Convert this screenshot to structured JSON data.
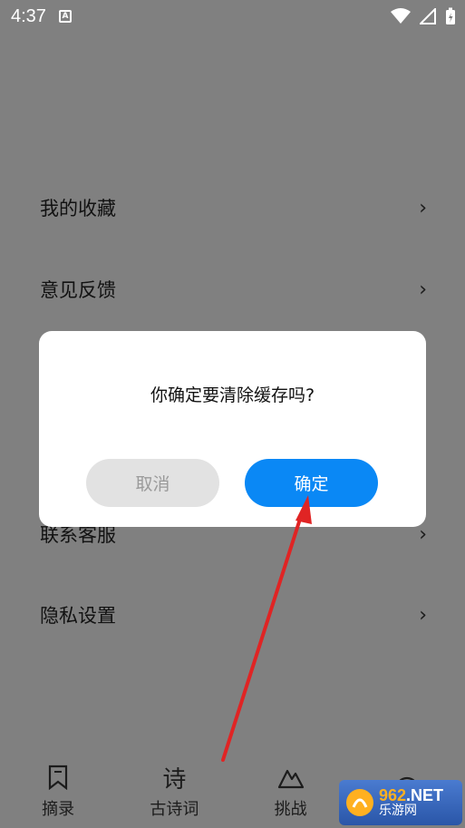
{
  "status_bar": {
    "time": "4:37",
    "notification_icon": "a-icon",
    "icons": [
      "wifi-icon",
      "signal-icon",
      "battery-icon"
    ]
  },
  "menu": {
    "items": [
      {
        "label": "我的收藏"
      },
      {
        "label": "意见反馈"
      },
      {
        "label": "联系客服"
      },
      {
        "label": "隐私设置"
      }
    ],
    "chevron": "›"
  },
  "bottom_nav": {
    "items": [
      {
        "label": "摘录",
        "icon": "bookmark-icon"
      },
      {
        "label": "古诗词",
        "icon": "poem-icon",
        "glyph": "诗"
      },
      {
        "label": "挑战",
        "icon": "mountain-icon"
      },
      {
        "label": "",
        "icon": "smiley-icon"
      }
    ]
  },
  "dialog": {
    "message": "你确定要清除缓存吗?",
    "cancel_label": "取消",
    "confirm_label": "确定"
  },
  "watermark": {
    "digits": "962",
    "suffix": ".NET",
    "subtitle": "乐游网"
  },
  "colors": {
    "confirm_button": "#0a88f5",
    "cancel_button": "#e2e2e2",
    "arrow": "#e02424"
  }
}
